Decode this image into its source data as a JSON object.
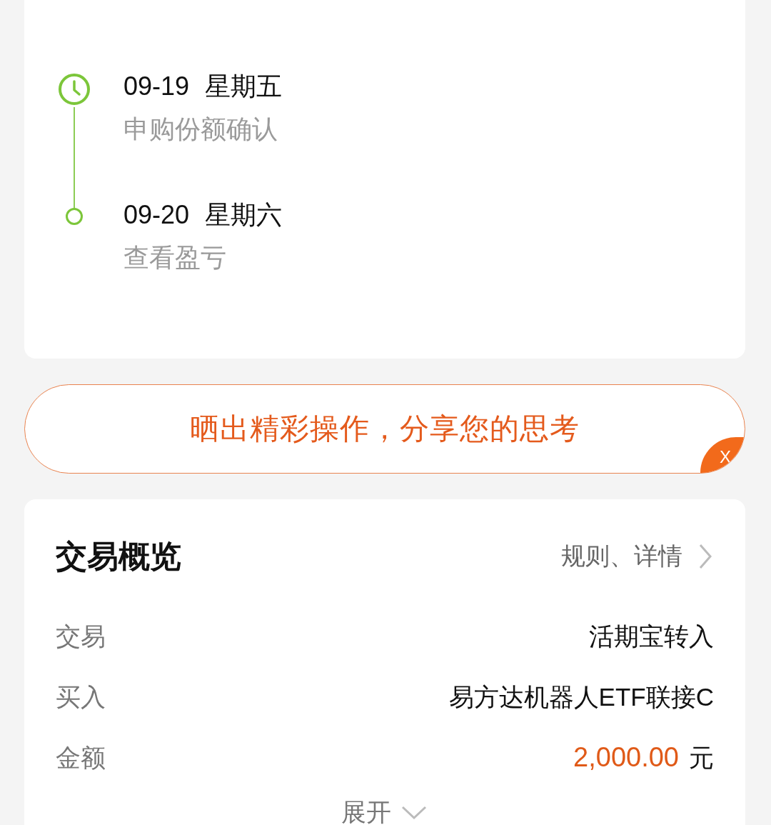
{
  "timeline": [
    {
      "kind": "clock",
      "date": "09-19",
      "weekday": "星期五",
      "description": "申购份额确认"
    },
    {
      "kind": "dot",
      "date": "09-20",
      "weekday": "星期六",
      "description": "查看盈亏"
    }
  ],
  "share_banner": {
    "text": "晒出精彩操作，分享您的思考",
    "close": "X"
  },
  "overview": {
    "title": "交易概览",
    "link": "规则、详情",
    "rows": [
      {
        "kind": "text",
        "label": "交易",
        "value": "活期宝转入"
      },
      {
        "kind": "text",
        "label": "买入",
        "value": "易方达机器人ETF联接C"
      },
      {
        "kind": "amount",
        "label": "金额",
        "value": "2,000.00",
        "unit": "元"
      }
    ],
    "expand": "展开"
  }
}
